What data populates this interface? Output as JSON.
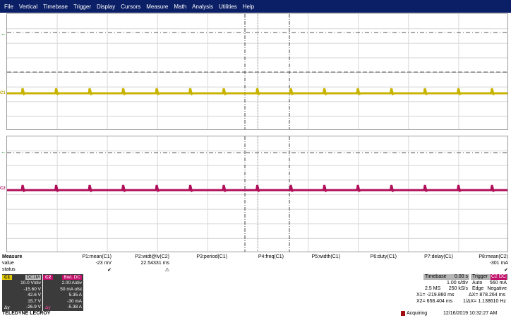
{
  "menu": [
    "File",
    "Vertical",
    "Timebase",
    "Trigger",
    "Display",
    "Cursors",
    "Measure",
    "Math",
    "Analysis",
    "Utilities",
    "Help"
  ],
  "channels": {
    "c1_tag": "C1",
    "c2_tag": "C2",
    "c1_color": "#c8b400",
    "c2_color": "#b0105a"
  },
  "measure": {
    "title": "Measure",
    "row_value": "value",
    "row_status": "status",
    "params": [
      {
        "name": "P1:mean(C1)",
        "value": "-23 mV",
        "status": "✔"
      },
      {
        "name": "P2:widt@lv(C2)",
        "value": "22.54331 ms",
        "status": "⚠"
      },
      {
        "name": "P3:period(C1)",
        "value": "",
        "status": ""
      },
      {
        "name": "P4:freq(C1)",
        "value": "",
        "status": ""
      },
      {
        "name": "P5:width(C1)",
        "value": "",
        "status": ""
      },
      {
        "name": "P6:duty(C1)",
        "value": "",
        "status": ""
      },
      {
        "name": "P7:delay(C1)",
        "value": "",
        "status": ""
      },
      {
        "name": "P8:mean(C2)",
        "value": "-301 mA",
        "status": "✔"
      }
    ]
  },
  "c1_box": {
    "label": "C1",
    "coupling": "DC1M",
    "rows": [
      "10.0 V/div",
      "-15.60 V",
      "42.6 V",
      "15.7 V",
      "-26.9 V"
    ],
    "dy": "Δy"
  },
  "c2_box": {
    "label": "C2",
    "coupling": "BwL DC",
    "rows": [
      "2.00 A/div",
      "50 mA ofst",
      "5.35 A",
      "-30 mA",
      "-5.38 A"
    ],
    "dy": "Δy"
  },
  "timebase": {
    "title": "Timebase",
    "offset": "0.00 s",
    "tdiv": "1.00 s/div",
    "samples": "2.5 MS",
    "rate": "250 kS/s"
  },
  "trigger": {
    "title": "Trigger",
    "channel": "C2 DC",
    "mode": "Auto",
    "level": "560 mA",
    "type": "Edge",
    "slope": "Negative"
  },
  "cursors": {
    "x1": "X1= -219.860 ms",
    "x2": "X2= 658.404 ms",
    "dx": "ΔX= 878.264 ms",
    "inv": "1/ΔX= 1.138610 Hz"
  },
  "footer": {
    "brand": "TELEDYNE LECROY",
    "status": "Acquiring",
    "datetime": "12/16/2019 10:32:27 AM"
  }
}
